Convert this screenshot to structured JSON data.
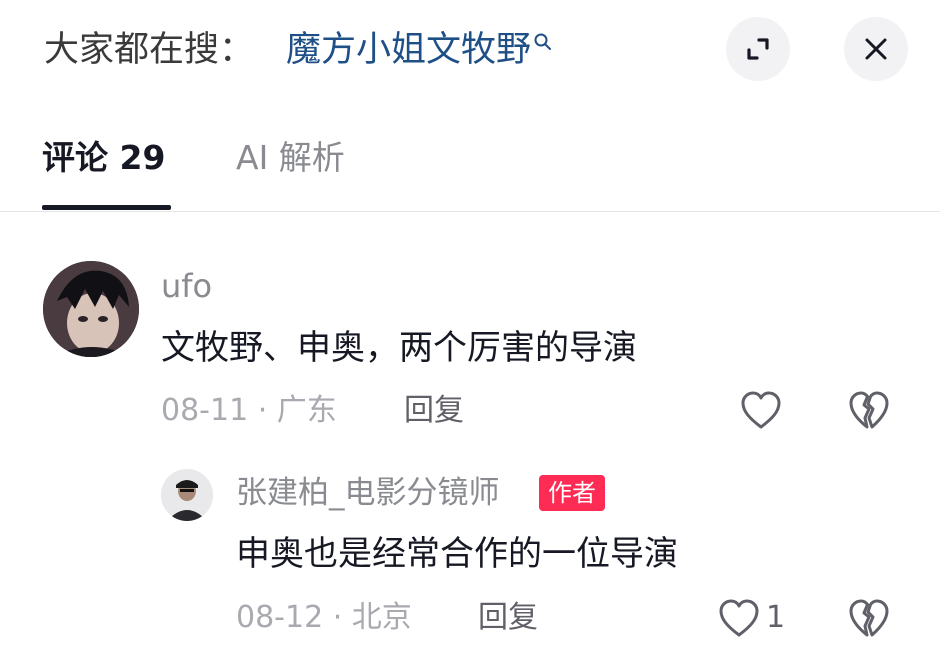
{
  "search_hint": {
    "label": "大家都在搜：",
    "query": "魔方小姐文牧野",
    "query_icon": "search-icon"
  },
  "header": {
    "expand_icon": "expand-icon",
    "close_icon": "close-icon"
  },
  "tabs": [
    {
      "label": "评论 29",
      "active": true
    },
    {
      "label": "AI 解析",
      "active": false
    }
  ],
  "comments": [
    {
      "username": "ufo",
      "text": "文牧野、申奥，两个厉害的导演",
      "meta": "08-11 · 广东",
      "reply_label": "回复",
      "like_icon": "heart-outline-icon",
      "dislike_icon": "broken-heart-icon"
    },
    {
      "username": "张建柏_电影分镜师",
      "badge": "作者",
      "text": "申奥也是经常合作的一位导演",
      "meta": "08-12 · 北京",
      "reply_label": "回复",
      "like_count": "1",
      "like_icon": "heart-outline-icon",
      "dislike_icon": "broken-heart-icon"
    }
  ],
  "colors": {
    "accent_link": "#1e4f86",
    "author_badge": "#fe2c55",
    "muted_text": "#a9aab0",
    "primary_text": "#161823"
  }
}
